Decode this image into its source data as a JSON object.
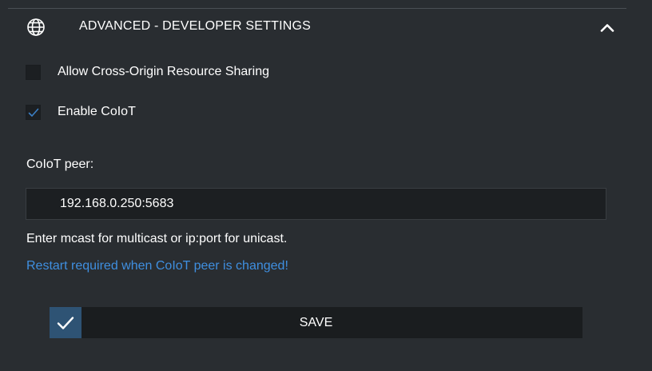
{
  "section": {
    "title": "ADVANCED - DEVELOPER SETTINGS",
    "icon": "globe-icon",
    "collapse_icon": "chevron-up-icon",
    "expanded": true
  },
  "options": {
    "cors": {
      "label": "Allow Cross-Origin Resource Sharing",
      "checked": false
    },
    "coiot": {
      "label": "Enable CoIoT",
      "checked": true
    }
  },
  "coiot_peer": {
    "label": "CoIoT peer:",
    "value": "192.168.0.250:5683",
    "hint": "Enter mcast for multicast or ip:port for unicast.",
    "warning": "Restart required when CoIoT peer is changed!"
  },
  "save": {
    "label": "SAVE",
    "icon": "check-icon"
  },
  "colors": {
    "background": "#292d31",
    "input_background": "#1c1f22",
    "accent": "#2e5374",
    "warning": "#3f8fe0",
    "check": "#3b7fc4"
  }
}
